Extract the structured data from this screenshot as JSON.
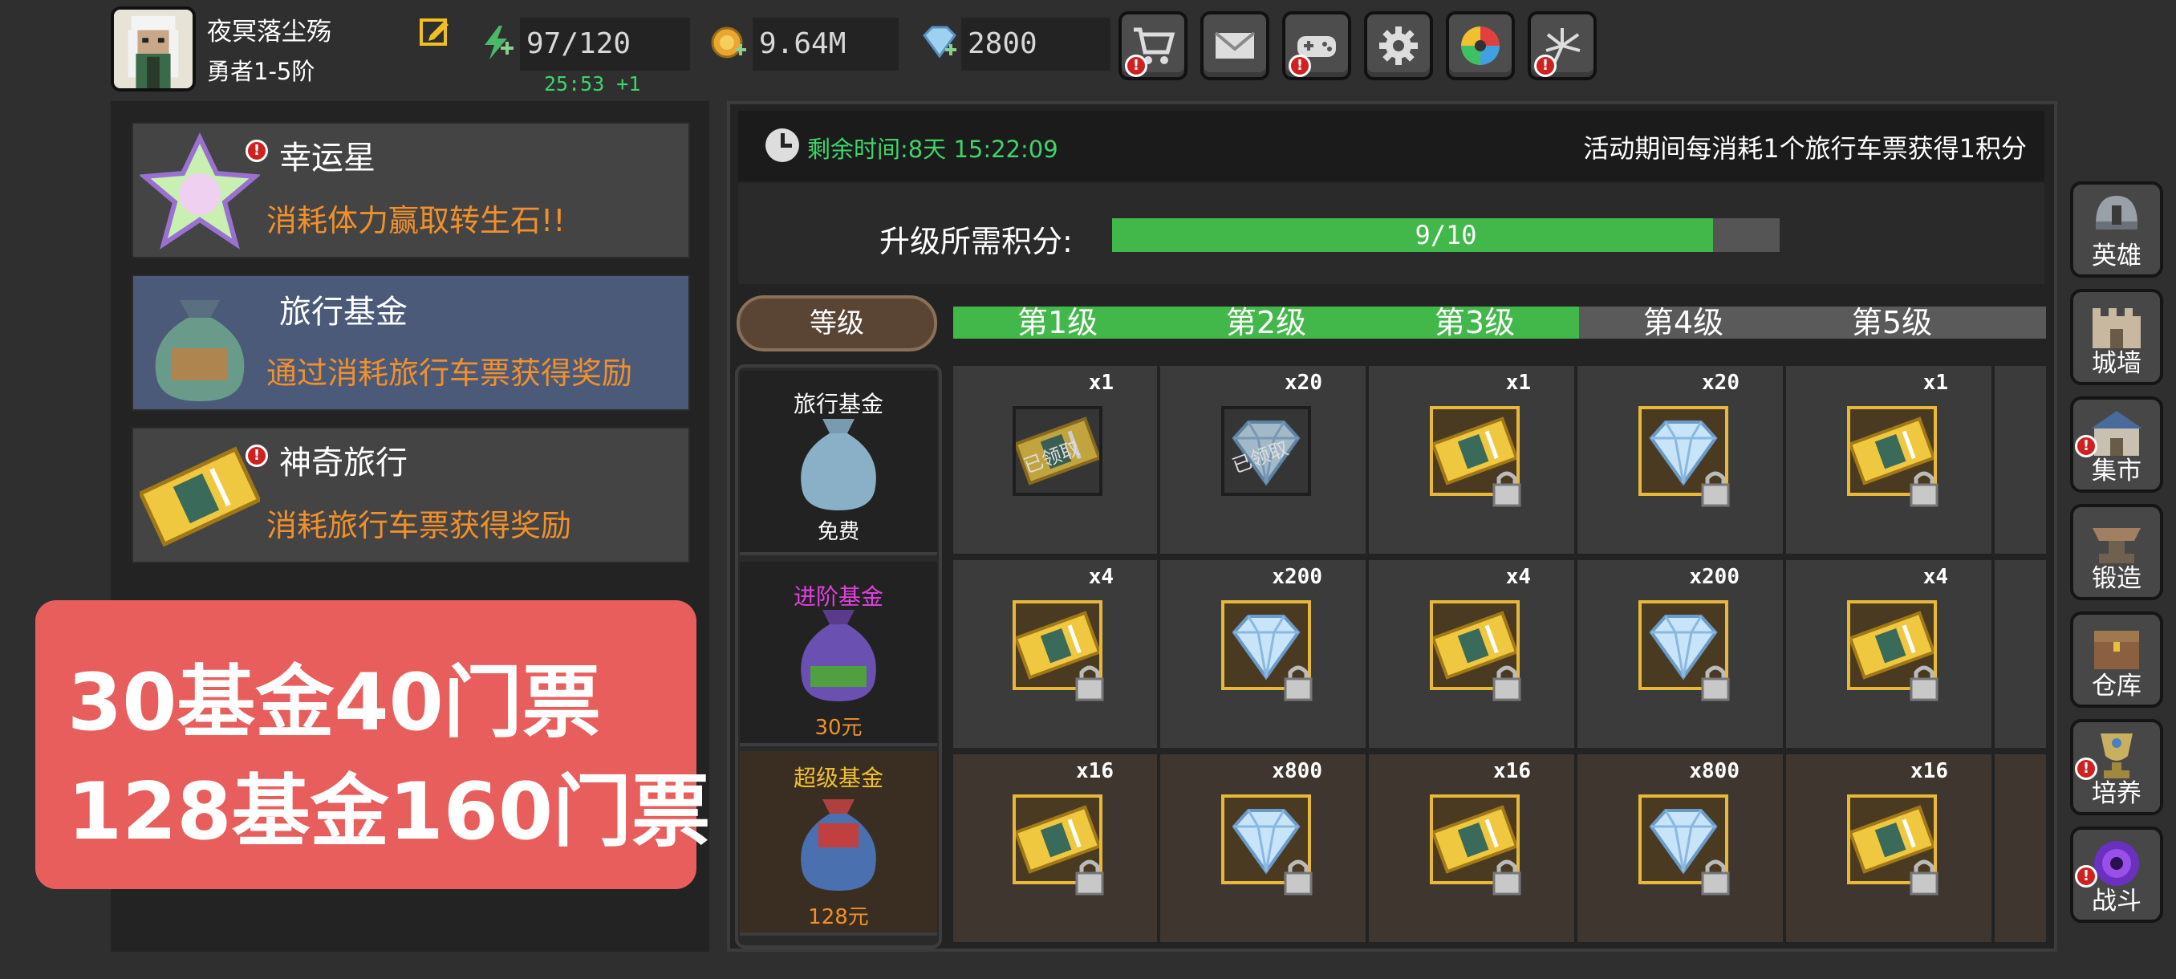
{
  "player": {
    "name": "夜冥落尘殇",
    "rank": "勇者1-5阶"
  },
  "resources": {
    "stamina": "97/120",
    "stamina_timer": "25:53 +1",
    "gold": "9.64M",
    "gems": "2800"
  },
  "top_buttons": [
    {
      "icon": "shopping-cart-icon",
      "badge": "!"
    },
    {
      "icon": "mail-icon",
      "badge": ""
    },
    {
      "icon": "gamepad-icon",
      "badge": "!"
    },
    {
      "icon": "gear-icon",
      "badge": ""
    },
    {
      "icon": "color-wheel-icon",
      "badge": ""
    },
    {
      "icon": "fireworks-icon",
      "badge": "!"
    }
  ],
  "events": [
    {
      "title": "幸运星",
      "subtitle": "消耗体力赢取转生石!!",
      "badge": "!",
      "active": false
    },
    {
      "title": "旅行基金",
      "subtitle": "通过消耗旅行车票获得奖励",
      "badge": "",
      "active": true
    },
    {
      "title": "神奇旅行",
      "subtitle": "消耗旅行车票获得奖励",
      "badge": "!",
      "active": false
    }
  ],
  "overlay": {
    "line1": "30基金40门票",
    "line2": "128基金160门票",
    "color": "#e85e5c"
  },
  "activity": {
    "time_label": "剩余时间:8天 15:22:09",
    "note": "活动期间每消耗1个旅行车票获得1积分",
    "progress_label": "升级所需积分:",
    "progress_text": "9/10",
    "progress_value": 9,
    "progress_max": 10,
    "level_label": "等级",
    "levels": [
      "第1级",
      "第2级",
      "第3级",
      "第4级",
      "第5级"
    ],
    "levels_reached": 3
  },
  "tiers": [
    {
      "name": "旅行基金",
      "price": "免费",
      "name_color": "#ffffff",
      "price_color": "#ffffff"
    },
    {
      "name": "进阶基金",
      "price": "30元",
      "name_color": "#e040e0",
      "price_color": "#f0902c"
    },
    {
      "name": "超级基金",
      "price": "128元",
      "name_color": "#f0c030",
      "price_color": "#f0902c"
    }
  ],
  "rewards": [
    [
      {
        "item": "ticket",
        "qty": "x1",
        "claimed": true,
        "claimed_text": "已领取"
      },
      {
        "item": "gem",
        "qty": "x20",
        "claimed": true,
        "claimed_text": "已领取"
      },
      {
        "item": "ticket",
        "qty": "x1",
        "claimed": false
      },
      {
        "item": "gem",
        "qty": "x20",
        "claimed": false
      },
      {
        "item": "ticket",
        "qty": "x1",
        "claimed": false
      }
    ],
    [
      {
        "item": "ticket",
        "qty": "x4",
        "claimed": false
      },
      {
        "item": "gem",
        "qty": "x200",
        "claimed": false
      },
      {
        "item": "ticket",
        "qty": "x4",
        "claimed": false
      },
      {
        "item": "gem",
        "qty": "x200",
        "claimed": false
      },
      {
        "item": "ticket",
        "qty": "x4",
        "claimed": false
      }
    ],
    [
      {
        "item": "ticket",
        "qty": "x16",
        "claimed": false
      },
      {
        "item": "gem",
        "qty": "x800",
        "claimed": false
      },
      {
        "item": "ticket",
        "qty": "x16",
        "claimed": false
      },
      {
        "item": "gem",
        "qty": "x800",
        "claimed": false
      },
      {
        "item": "ticket",
        "qty": "x16",
        "claimed": false
      }
    ]
  ],
  "side_menu": [
    {
      "label": "英雄",
      "icon": "helmet-icon",
      "badge": ""
    },
    {
      "label": "城墙",
      "icon": "castle-wall-icon",
      "badge": ""
    },
    {
      "label": "集市",
      "icon": "market-icon",
      "badge": "!"
    },
    {
      "label": "锻造",
      "icon": "anvil-icon",
      "badge": ""
    },
    {
      "label": "仓库",
      "icon": "chest-icon",
      "badge": ""
    },
    {
      "label": "培养",
      "icon": "trophy-icon",
      "badge": "!"
    },
    {
      "label": "战斗",
      "icon": "portal-icon",
      "badge": "!"
    }
  ],
  "colors": {
    "green": "#43b84a",
    "orange": "#f0902c",
    "gold_frame": "#e8b838",
    "badge_red": "#d02020"
  }
}
